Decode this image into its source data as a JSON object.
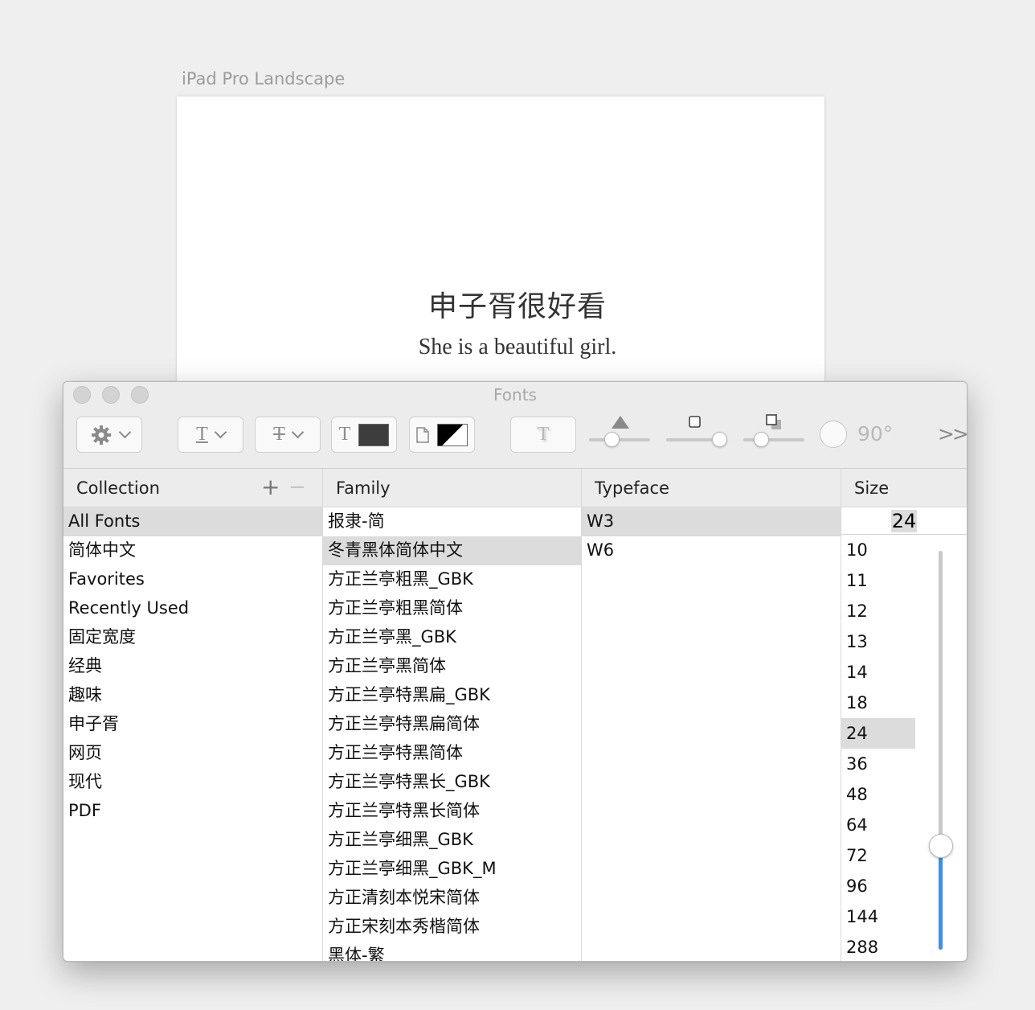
{
  "artboard": {
    "label": "iPad Pro Landscape",
    "chinese_text": "申子胥很好看",
    "english_text": "She is a beautiful girl."
  },
  "window": {
    "title": "Fonts"
  },
  "toolbar": {
    "rotation_label": "90°",
    "more_label": ">>",
    "icons": [
      "gear-icon",
      "text-underline-icon",
      "text-strikethrough-icon",
      "text-color-icon",
      "document-color-icon",
      "text-shadow-icon"
    ],
    "colors": {
      "text_color": "#3d3d3d",
      "slider_fill": "#3d8fef"
    }
  },
  "collection": {
    "header": "Collection",
    "add_label": "+",
    "remove_label": "—",
    "items": [
      "All Fonts",
      "简体中文",
      "Favorites",
      "Recently Used",
      "固定宽度",
      "经典",
      "趣味",
      "申子胥",
      "网页",
      "现代",
      "PDF"
    ],
    "selected": "All Fonts"
  },
  "family": {
    "header": "Family",
    "items": [
      "报隶-简",
      "冬青黑体简体中文",
      "方正兰亭粗黑_GBK",
      "方正兰亭粗黑简体",
      "方正兰亭黑_GBK",
      "方正兰亭黑简体",
      "方正兰亭特黑扁_GBK",
      "方正兰亭特黑扁简体",
      "方正兰亭特黑简体",
      "方正兰亭特黑长_GBK",
      "方正兰亭特黑长简体",
      "方正兰亭细黑_GBK",
      "方正兰亭细黑_GBK_M",
      "方正清刻本悦宋简体",
      "方正宋刻本秀楷简体",
      "黑体-繁"
    ],
    "selected": "冬青黑体简体中文"
  },
  "typeface": {
    "header": "Typeface",
    "items": [
      "W3",
      "W6"
    ],
    "selected": "W3"
  },
  "size": {
    "header": "Size",
    "current": "24",
    "items": [
      "10",
      "11",
      "12",
      "13",
      "14",
      "18",
      "24",
      "36",
      "48",
      "64",
      "72",
      "96",
      "144",
      "288"
    ],
    "selected": "24"
  }
}
